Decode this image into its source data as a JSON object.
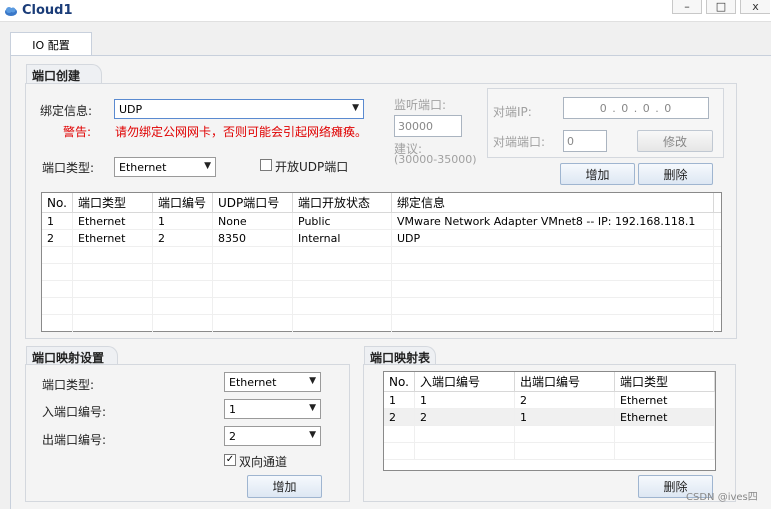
{
  "window": {
    "title": "Cloud1",
    "controls": [
      "–",
      "□",
      "x"
    ]
  },
  "tabs": [
    {
      "label": "IO 配置"
    }
  ],
  "port_create": {
    "title": "端口创建",
    "bind_label": "绑定信息:",
    "bind_value": "UDP",
    "warning_label": "警告:",
    "warning_text": "请勿绑定公网网卡，否则可能会引起网络瘫痪。",
    "port_type_label": "端口类型:",
    "port_type_value": "Ethernet",
    "open_udp_label": "开放UDP端口",
    "open_udp_checked": false,
    "listen_port_label": "监听端口:",
    "listen_port_value": "30000",
    "suggest_label": "建议:",
    "suggest_range": "(30000-35000)",
    "peer_ip_label": "对端IP:",
    "peer_ip_value": "0 . 0 . 0 . 0",
    "peer_port_label": "对端端口:",
    "peer_port_value": "0",
    "modify_button": "修改",
    "add_button": "增加",
    "delete_button": "删除"
  },
  "port_table": {
    "columns": [
      "No.",
      "端口类型",
      "端口编号",
      "UDP端口号",
      "端口开放状态",
      "绑定信息"
    ],
    "rows": [
      [
        "1",
        "Ethernet",
        "1",
        "None",
        "Public",
        "VMware Network Adapter VMnet8 -- IP: 192.168.118.1"
      ],
      [
        "2",
        "Ethernet",
        "2",
        "8350",
        "Internal",
        "UDP"
      ]
    ]
  },
  "mapping_settings": {
    "title": "端口映射设置",
    "port_type_label": "端口类型:",
    "port_type_value": "Ethernet",
    "in_port_label": "入端口编号:",
    "in_port_value": "1",
    "out_port_label": "出端口编号:",
    "out_port_value": "2",
    "bidirectional_label": "双向通道",
    "bidirectional_checked": true,
    "add_button": "增加"
  },
  "mapping_table": {
    "title": "端口映射表",
    "columns": [
      "No.",
      "入端口编号",
      "出端口编号",
      "端口类型"
    ],
    "rows": [
      [
        "1",
        "1",
        "2",
        "Ethernet"
      ],
      [
        "2",
        "2",
        "1",
        "Ethernet"
      ]
    ],
    "delete_button": "删除"
  },
  "watermark": "CSDN @ives四",
  "colors": {
    "warning": "#e00000",
    "title": "#1a3c78",
    "select_highlight": "#5a8ad0"
  },
  "icons": {
    "app": "cloud-icon",
    "dropdown": "chevron-down-icon",
    "check": "checkmark-icon"
  }
}
